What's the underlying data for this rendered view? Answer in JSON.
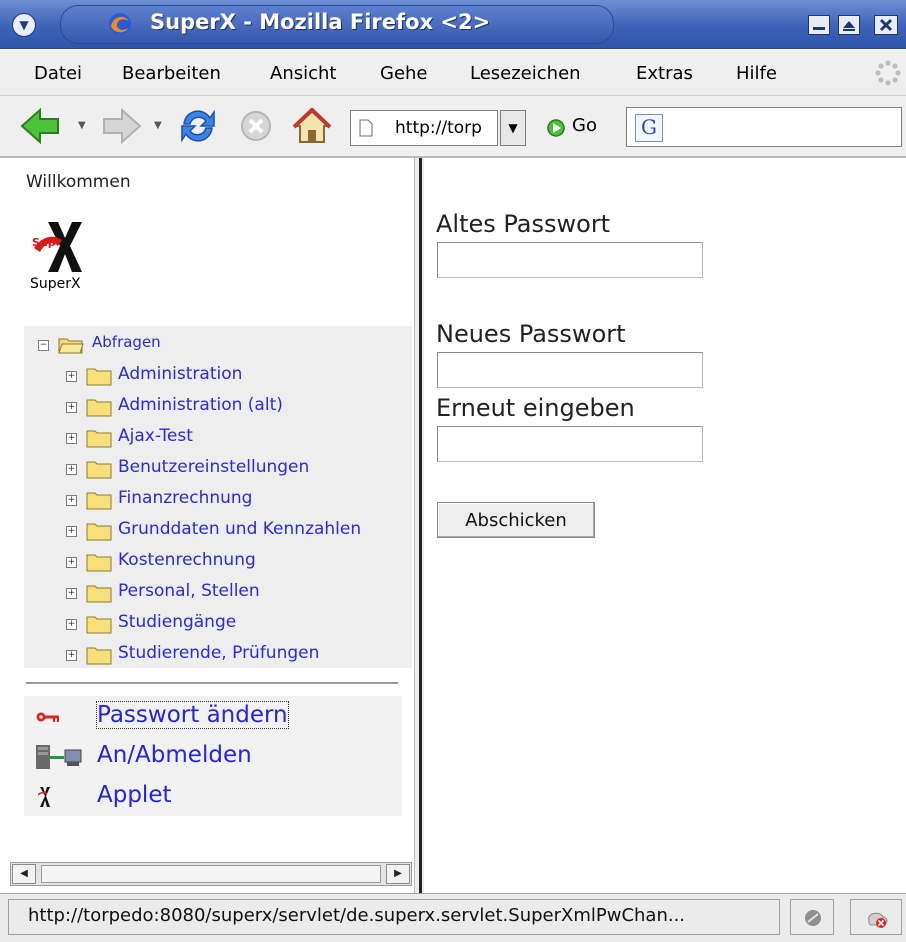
{
  "window": {
    "title": "SuperX - Mozilla Firefox <2>"
  },
  "menubar": {
    "items": [
      "Datei",
      "Bearbeiten",
      "Ansicht",
      "Gehe",
      "Lesezeichen",
      "Extras",
      "Hilfe"
    ]
  },
  "toolbar": {
    "url": "http://torp",
    "go_label": "Go"
  },
  "left": {
    "welcome": "Willkommen",
    "logo_caption": "SuperX",
    "tree": {
      "root": "Abfragen",
      "children": [
        "Administration",
        "Administration (alt)",
        "Ajax-Test",
        "Benutzereinstellungen",
        "Finanzrechnung",
        "Grunddaten und Kennzahlen",
        "Kostenrechnung",
        "Personal, Stellen",
        "Studiengänge",
        "Studierende, Prüfungen"
      ]
    },
    "links": {
      "password": "Passwort ändern",
      "login": "An/Abmelden",
      "applet": "Applet"
    }
  },
  "form": {
    "old_password_label": "Altes Passwort",
    "new_password_label": "Neues Passwort",
    "repeat_label": "Erneut eingeben",
    "submit_label": "Abschicken"
  },
  "statusbar": {
    "text": "http://torpedo:8080/superx/servlet/de.superx.servlet.SuperXmlPwChan..."
  },
  "colors": {
    "titlebar": "#3d62b8",
    "link": "#2323e6",
    "tree_link": "#2a2ad8"
  }
}
